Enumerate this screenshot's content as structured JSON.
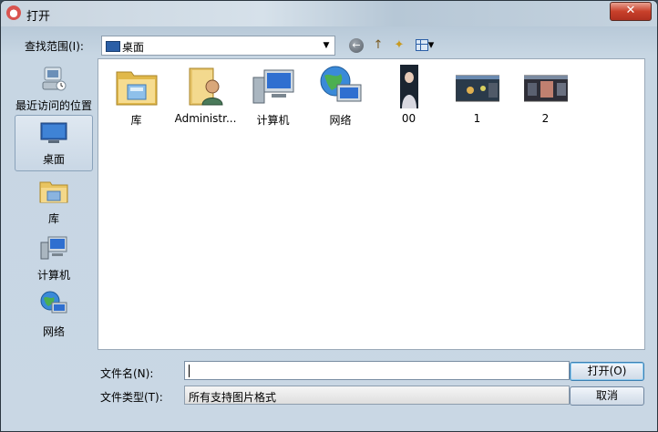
{
  "window": {
    "title": "打开",
    "close_symbol": "✕"
  },
  "toolbar": {
    "lookin_label": "查找范围(I):",
    "lookin_value": "桌面",
    "back_icon": "←",
    "up_icon": "↑",
    "new_folder_icon": "✦",
    "view_icon": "▾"
  },
  "sidebar": {
    "items": [
      {
        "label": "最近访问的位置",
        "icon": "recent-places-icon"
      },
      {
        "label": "桌面",
        "icon": "desktop-icon"
      },
      {
        "label": "库",
        "icon": "library-icon"
      },
      {
        "label": "计算机",
        "icon": "computer-icon"
      },
      {
        "label": "网络",
        "icon": "network-icon"
      }
    ]
  },
  "files": [
    {
      "label": "库",
      "icon": "library-icon"
    },
    {
      "label": "Administr...",
      "icon": "user-folder-icon"
    },
    {
      "label": "计算机",
      "icon": "computer-icon"
    },
    {
      "label": "网络",
      "icon": "network-icon"
    },
    {
      "label": "00",
      "icon": "photo-thumbnail"
    },
    {
      "label": "1",
      "icon": "screenshot-thumbnail"
    },
    {
      "label": "2",
      "icon": "screenshot-thumbnail"
    }
  ],
  "footer": {
    "filename_label": "文件名(N):",
    "filename_value": "",
    "filetype_label": "文件类型(T):",
    "filetype_value": "所有支持图片格式",
    "open_button": "打开(O)",
    "cancel_button": "取消"
  }
}
